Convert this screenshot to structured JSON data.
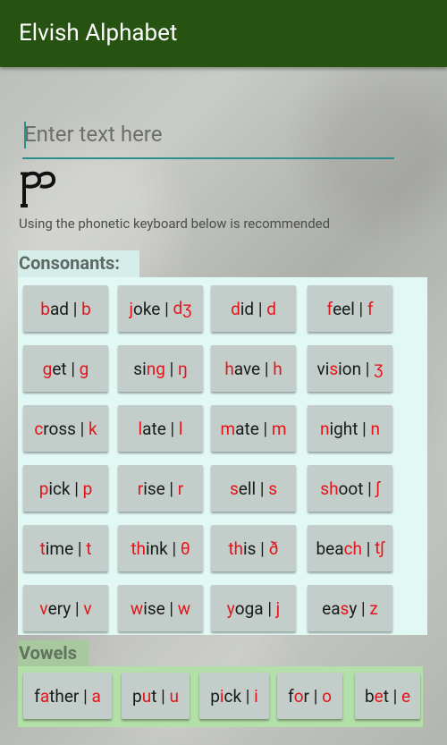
{
  "app": {
    "title": "Elvish Alphabet"
  },
  "input": {
    "placeholder": "Enter text here"
  },
  "hint": "Using the phonetic keyboard below is recommended",
  "consonants_label": "Consonants:",
  "vowels_label": "Vowels",
  "accent_color": "#e3151b",
  "consonants": [
    [
      {
        "s": [
          "",
          "b",
          "ad | ",
          "b"
        ]
      },
      {
        "s": [
          "",
          "j",
          "oke | ",
          "dʒ"
        ]
      },
      {
        "s": [
          "",
          "d",
          "id | ",
          "d"
        ]
      },
      {
        "s": [
          "",
          "f",
          "eel | ",
          "f"
        ]
      }
    ],
    [
      {
        "s": [
          "",
          "g",
          "et | ",
          "g"
        ]
      },
      {
        "s": [
          "si",
          "ng",
          " | ",
          "ŋ"
        ]
      },
      {
        "s": [
          "",
          "h",
          "ave | ",
          "h"
        ]
      },
      {
        "s": [
          "vi",
          "s",
          "ion | ",
          "ʒ"
        ]
      }
    ],
    [
      {
        "s": [
          "",
          "c",
          "ross | ",
          "k"
        ]
      },
      {
        "s": [
          "",
          "l",
          "ate | ",
          "l"
        ]
      },
      {
        "s": [
          "",
          "m",
          "ate | ",
          "m"
        ]
      },
      {
        "s": [
          "",
          "n",
          "ight | ",
          "n"
        ]
      }
    ],
    [
      {
        "s": [
          "",
          "p",
          "ick | ",
          "p"
        ]
      },
      {
        "s": [
          "",
          "r",
          "ise | ",
          "r"
        ]
      },
      {
        "s": [
          "",
          "s",
          "ell | ",
          "s"
        ]
      },
      {
        "s": [
          "",
          "sh",
          "oot | ",
          "ʃ"
        ]
      }
    ],
    [
      {
        "s": [
          "",
          "t",
          "ime | ",
          "t"
        ]
      },
      {
        "s": [
          "",
          "th",
          "ink | ",
          "θ"
        ]
      },
      {
        "s": [
          "",
          "th",
          "is | ",
          "ð"
        ]
      },
      {
        "s": [
          "bea",
          "ch",
          " | ",
          "tʃ"
        ]
      }
    ],
    [
      {
        "s": [
          "",
          "v",
          "ery | ",
          "v"
        ]
      },
      {
        "s": [
          "",
          "w",
          "ise | ",
          "w"
        ]
      },
      {
        "s": [
          "",
          "y",
          "oga | ",
          "j"
        ]
      },
      {
        "s": [
          "ea",
          "s",
          "y | ",
          "z"
        ]
      }
    ]
  ],
  "vowels": [
    {
      "s": [
        "f",
        "a",
        "ther | ",
        "a"
      ]
    },
    {
      "s": [
        "p",
        "u",
        "t | ",
        "u"
      ]
    },
    {
      "s": [
        "p",
        "i",
        "ck | ",
        "i"
      ]
    },
    {
      "s": [
        "f",
        "o",
        "r | ",
        "o"
      ]
    },
    {
      "s": [
        "b",
        "e",
        "t | ",
        "e"
      ]
    }
  ]
}
